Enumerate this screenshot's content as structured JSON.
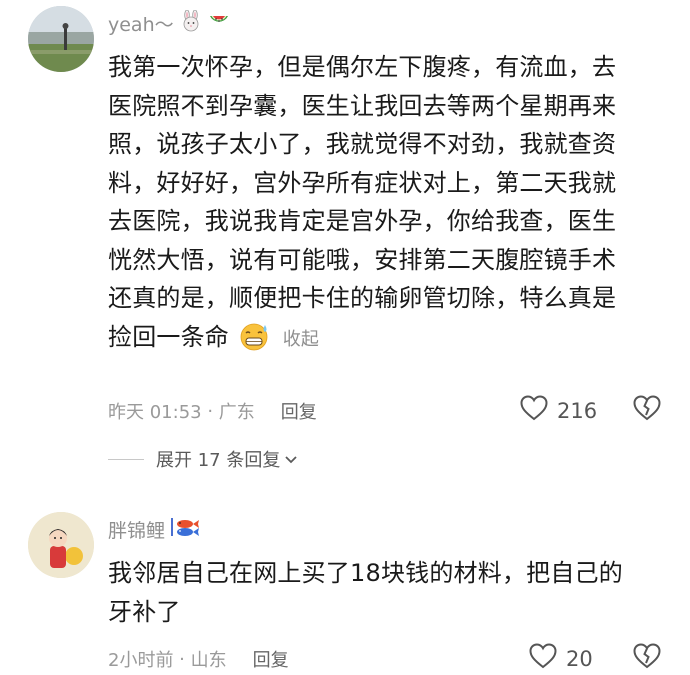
{
  "comments": [
    {
      "username": "yeah～",
      "body_lines": [
        "我第一次怀孕，但是偶尔左下腹疼，有流血，去",
        "医院照不到孕囊，医生让我回去等两个星期再来",
        "照，说孩子太小了，我就觉得不对劲，我就查资",
        "料，好好好，宫外孕所有症状对上，第二天我就",
        "去医院，我说我肯定是宫外孕，你给我查，医生",
        "恍然大悟，说有可能哦，安排第二天腹腔镜手术",
        "还真的是，顺便把卡住的输卵管切除，特么真是",
        "捡回一条命"
      ],
      "fold_label": "收起",
      "time": "昨天 01:53",
      "location": "广东",
      "reply_label": "回复",
      "likes": "216"
    },
    {
      "username": "胖锦鲤",
      "body_lines": [
        "我邻居自己在网上买了18块钱的材料，把自己的",
        "牙补了"
      ],
      "time": "2小时前",
      "location": "山东",
      "reply_label": "回复",
      "likes": "20"
    }
  ],
  "expand_replies": "展开 17 条回复",
  "colors": {
    "meta_gray": "#9a9a9a",
    "text": "#1a1a1a",
    "username_gray": "#8f8f8f"
  }
}
